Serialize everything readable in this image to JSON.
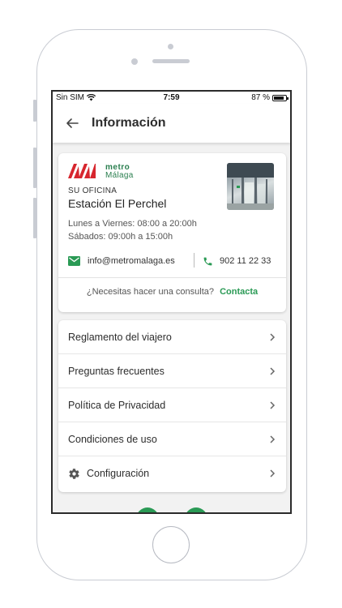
{
  "status_bar": {
    "carrier": "Sin SIM",
    "time": "7:59",
    "battery": "87 %",
    "battery_level": 0.87
  },
  "app_bar": {
    "title": "Información"
  },
  "info_card": {
    "logo_metro": "metro",
    "logo_city": "Málaga",
    "office_label": "SU OFICINA",
    "office_name": "Estación El Perchel",
    "hours_weekdays": "Lunes a Viernes: 08:00 a 20:00h",
    "hours_saturday": "Sábados: 09:00h a 15:00h",
    "email": "info@metromalaga.es",
    "phone": "902 11 22 33",
    "consult_question": "¿Necesitas hacer una consulta?",
    "consult_link": "Contacta"
  },
  "menu": {
    "items": [
      {
        "label": "Reglamento del viajero"
      },
      {
        "label": "Preguntas frecuentes"
      },
      {
        "label": "Política de Privacidad"
      },
      {
        "label": "Condiciones de uso"
      },
      {
        "label": "Configuración",
        "icon": "gear-icon"
      }
    ]
  },
  "colors": {
    "accent_green": "#2a9a55",
    "logo_red": "#d7262e",
    "logo_green": "#2a7f4f"
  }
}
